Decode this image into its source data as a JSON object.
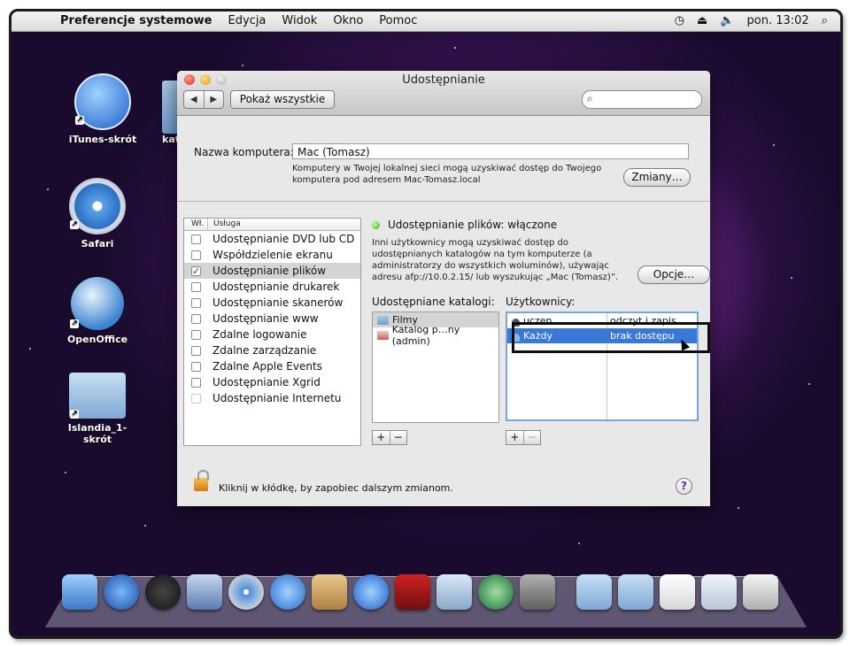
{
  "menubar": {
    "app_name": "Preferencje systemowe",
    "menus": [
      "Edycja",
      "Widok",
      "Okno",
      "Pomoc"
    ],
    "clock": "pon. 13:02"
  },
  "desktop": {
    "icons": [
      {
        "label": "iTunes-skrót",
        "icon": "itunes-icon"
      },
      {
        "label": "Safari",
        "icon": "safari-icon"
      },
      {
        "label": "OpenOffice",
        "icon": "openoffice-icon"
      },
      {
        "label": "Islandia_1-skrót",
        "icon": "folder-icon"
      }
    ],
    "partial_label": "kat"
  },
  "window": {
    "title": "Udostępnianie",
    "show_all": "Pokaż wszystkie",
    "computer_name_label": "Nazwa komputera:",
    "computer_name_value": "Mac (Tomasz)",
    "computer_name_desc": "Komputery w Twojej lokalnej sieci mogą uzyskiwać dostęp do Twojego komputera pod adresem Mac-Tomasz.local",
    "change_button": "Zmiany…",
    "services_header": {
      "on": "Wł.",
      "service": "Usługa"
    },
    "services": [
      {
        "name": "Udostępnianie DVD lub CD",
        "checked": false
      },
      {
        "name": "Współdzielenie ekranu",
        "checked": false
      },
      {
        "name": "Udostępnianie plików",
        "checked": true
      },
      {
        "name": "Udostępnianie drukarek",
        "checked": false
      },
      {
        "name": "Udostępnianie skanerów",
        "checked": false
      },
      {
        "name": "Udostępnianie www",
        "checked": false
      },
      {
        "name": "Zdalne logowanie",
        "checked": false
      },
      {
        "name": "Zdalne zarządzanie",
        "checked": false
      },
      {
        "name": "Zdalne Apple Events",
        "checked": false
      },
      {
        "name": "Udostępnianie Xgrid",
        "checked": false
      },
      {
        "name": "Udostępnianie Internetu",
        "checked": false
      }
    ],
    "status": "Udostępnianie plików: włączone",
    "info": "Inni użytkownicy mogą uzyskiwać dostęp do udostępnianych katalogów na tym komputerze (a administratorzy do wszystkich woluminów), używając adresu afp://10.0.2.15/ lub wyszukując „Mac (Tomasz)”.",
    "options_button": "Opcje…",
    "shared_folders_label": "Udostępniane katalogi:",
    "shared_folders": [
      "Filmy",
      "Katalog p…ny (admin)"
    ],
    "users_label": "Użytkownicy:",
    "users": [
      {
        "name": "uczen",
        "access": "odczyt i zapis"
      },
      {
        "name": "Każdy",
        "access": "brak dostępu"
      }
    ],
    "add": "+",
    "remove": "−",
    "lock_message": "Kliknij w kłódkę, by zapobiec dalszym zmianom.",
    "help": "?"
  },
  "colors": {
    "selection": "#3a78d6",
    "status_led": "#3ab018"
  }
}
